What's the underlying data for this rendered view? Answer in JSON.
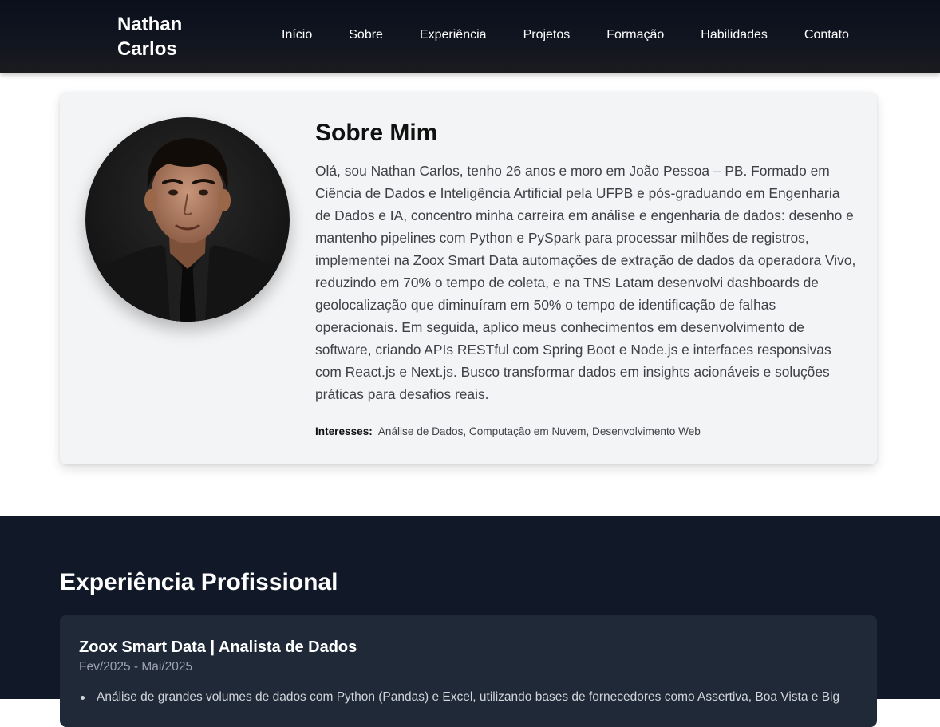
{
  "header": {
    "brand": "Nathan Carlos",
    "nav": [
      "Início",
      "Sobre",
      "Experiência",
      "Projetos",
      "Formação",
      "Habilidades",
      "Contato"
    ]
  },
  "about": {
    "title": "Sobre Mim",
    "avatar_alt": "profile-photo",
    "text": "Olá, sou Nathan Carlos, tenho 26 anos e moro em João Pessoa – PB. Formado em Ciência de Dados e Inteligência Artificial pela UFPB e pós-graduando em Engenharia de Dados e IA, concentro minha carreira em análise e engenharia de dados: desenho e mantenho pipelines com Python e PySpark para processar milhões de registros, implementei na Zoox Smart Data automações de extração de dados da operadora Vivo, reduzindo em 70% o tempo de coleta, e na TNS Latam desenvolvi dashboards de geolocalização que diminuíram em 50% o tempo de identificação de falhas operacionais. Em seguida, aplico meus conhecimentos em desenvolvimento de software, criando APIs RESTful com Spring Boot e Node.js e interfaces responsivas com React.js e Next.js. Busco transformar dados em insights acionáveis e soluções práticas para desafios reais.",
    "interests_label": "Interesses:",
    "interests": "Análise de Dados, Computação em Nuvem, Desenvolvimento Web"
  },
  "experience": {
    "title": "Experiência Profissional",
    "items": [
      {
        "role": "Zoox Smart Data | Analista de Dados",
        "period": "Fev/2025 - Mai/2025",
        "bullets": [
          "Análise de grandes volumes de dados com Python (Pandas) e Excel, utilizando bases de fornecedores como Assertiva, Boa Vista e Big"
        ]
      }
    ]
  },
  "colors": {
    "nav_bg": "#0b0f1c",
    "card_bg": "#f3f4f6",
    "section_dark": "#111827",
    "exp_card": "#1f2937"
  }
}
